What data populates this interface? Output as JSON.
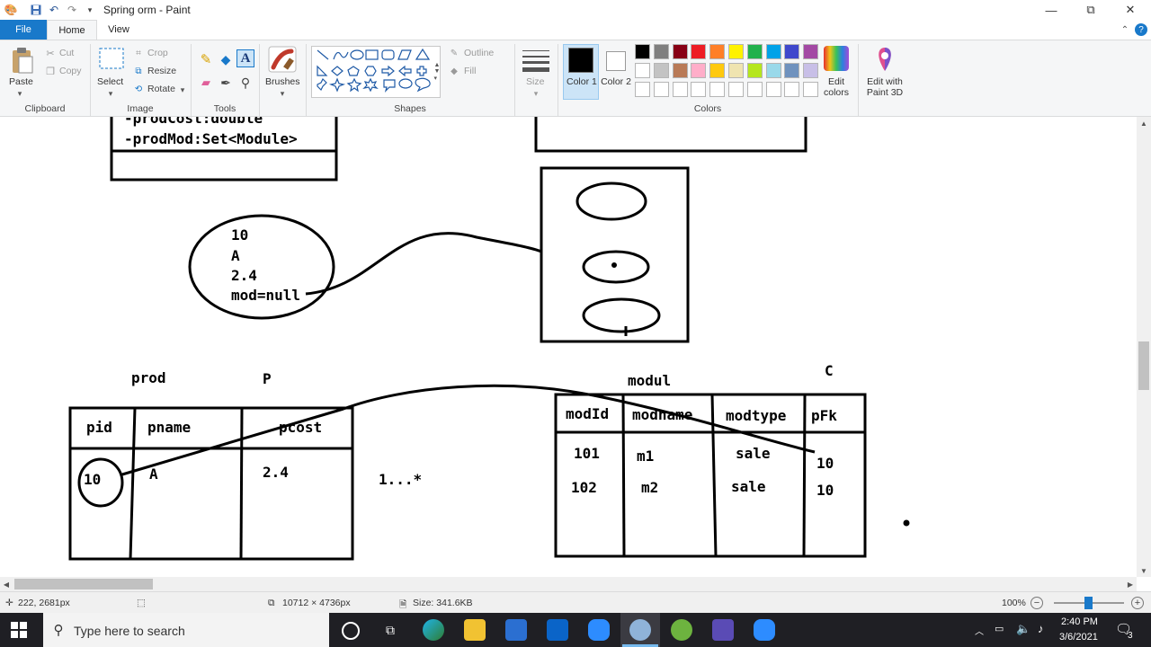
{
  "window": {
    "title": "Spring orm - Paint",
    "minimize_glyph": "—",
    "maximize_glyph": "⧉",
    "close_glyph": "✕"
  },
  "tabs": {
    "file": "File",
    "home": "Home",
    "view": "View"
  },
  "clipboard": {
    "paste": "Paste",
    "cut": "Cut",
    "copy": "Copy",
    "label": "Clipboard"
  },
  "image": {
    "select": "Select",
    "crop": "Crop",
    "resize": "Resize",
    "rotate": "Rotate",
    "label": "Image"
  },
  "tools": {
    "label": "Tools"
  },
  "brushes": {
    "label": "Brushes"
  },
  "shapes": {
    "outline": "Outline",
    "fill": "Fill",
    "label": "Shapes"
  },
  "size": {
    "label": "Size"
  },
  "colors": {
    "color1": "Color 1",
    "color2": "Color 2",
    "edit_colors": "Edit colors",
    "label": "Colors",
    "palette_row1": [
      "#000000",
      "#7f7f7f",
      "#880015",
      "#ed1c24",
      "#ff7f27",
      "#fff200",
      "#22b14c",
      "#00a2e8",
      "#3f48cc",
      "#a349a4"
    ],
    "palette_row2": [
      "#ffffff",
      "#c3c3c3",
      "#b97a57",
      "#ffaec9",
      "#ffc90e",
      "#efe4b0",
      "#b5e61d",
      "#99d9ea",
      "#7092be",
      "#c8bfe7"
    ]
  },
  "paint3d": {
    "label": "Edit with Paint 3D"
  },
  "canvas": {
    "class_box_lines": [
      "-prodCost:double",
      "-prodMod:Set<Module>"
    ],
    "object_lines": [
      "10",
      "A",
      "2.4",
      "mod=null"
    ],
    "prod_label": "prod",
    "p_label": "P",
    "prod_headers": [
      "pid",
      "pname",
      "pcost"
    ],
    "prod_row": [
      "10",
      "A",
      "2.4"
    ],
    "multiplicity": "1...*",
    "modul_label": "modul",
    "c_label": "C",
    "mod_headers": [
      "modId",
      "modname",
      "modtype",
      "pFk"
    ],
    "mod_rows": [
      [
        "101",
        "m1",
        "sale",
        "10"
      ],
      [
        "102",
        "m2",
        "sale",
        "10"
      ]
    ]
  },
  "status": {
    "cursor_pos": "222, 2681px",
    "canvas_size": "10712 × 4736px",
    "file_size": "Size: 341.6KB",
    "zoom": "100%"
  },
  "taskbar": {
    "search_placeholder": "Type here to search",
    "time": "2:40 PM",
    "date": "3/6/2021",
    "notifications": "3"
  }
}
